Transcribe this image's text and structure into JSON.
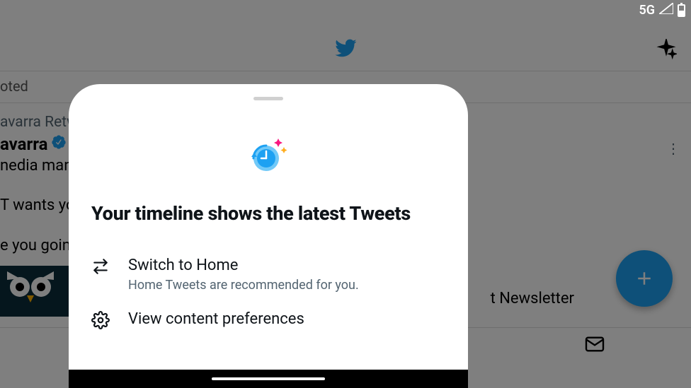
{
  "status_bar": {
    "network": "5G"
  },
  "background": {
    "tab": "oted",
    "retweet_label": "avarra Retwe",
    "author_name": "avarra",
    "author_handle": "@",
    "author_bio": "nedia man",
    "tweet_line1": "T wants yo",
    "tweet_line2": "e you goin",
    "newsletter": "t Newsletter"
  },
  "sheet": {
    "title": "Your timeline shows the latest Tweets",
    "options": [
      {
        "title": "Switch to Home",
        "subtitle": "Home Tweets are recommended for you."
      },
      {
        "title": "View content preferences"
      }
    ]
  }
}
